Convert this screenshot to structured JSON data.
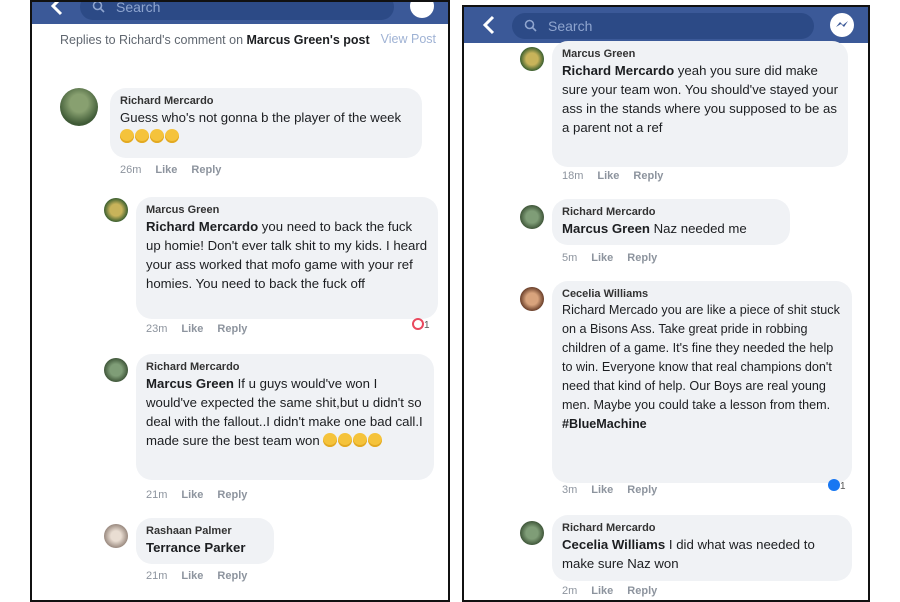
{
  "colors": {
    "fb_blue": "#3b5998",
    "bubble_bg": "#f0f2f5",
    "meta_gray": "#8d949e",
    "angry_red": "#e9495e",
    "like_blue": "#1877f2"
  },
  "left": {
    "search_placeholder": "Search",
    "header_prefix": "Replies to Richard's comment on",
    "header_owner": "Marcus Green's post",
    "view_post": "View Post",
    "comments": [
      {
        "author": "Richard Mercardo",
        "mention": "",
        "text": "Guess who's not gonna b the player of the week",
        "emoji_count": 4,
        "time": "26m",
        "like": "Like",
        "reply": "Reply"
      },
      {
        "author": "Marcus Green",
        "mention": "Richard Mercardo",
        "text": " you need to back the fuck up homie! Don't ever talk shit to my kids. I heard your ass worked that mofo game with your ref homies. You need to back the fuck off",
        "time": "23m",
        "like": "Like",
        "reply": "Reply",
        "reaction_count": "1"
      },
      {
        "author": "Richard Mercardo",
        "mention": "Marcus Green",
        "text": " If u guys would've won I would've expected the same shit,but u didn't so deal with the fallout..I didn't make one bad call.I made sure the best team won",
        "emoji_count": 4,
        "time": "21m",
        "like": "Like",
        "reply": "Reply"
      },
      {
        "author": "Rashaan Palmer",
        "mention": "Terrance Parker",
        "text": "",
        "time": "21m",
        "like": "Like",
        "reply": "Reply"
      }
    ]
  },
  "right": {
    "search_placeholder": "Search",
    "comments": [
      {
        "author": "Marcus Green",
        "mention": "Richard Mercardo",
        "text": "  yeah you sure did make sure your team won. You should've stayed your ass in the stands where you supposed to be as a parent not a ref",
        "time": "18m",
        "like": "Like",
        "reply": "Reply"
      },
      {
        "author": "Richard Mercardo",
        "mention": "Marcus Green",
        "text": " Naz needed me",
        "time": "5m",
        "like": "Like",
        "reply": "Reply"
      },
      {
        "author": "Cecelia Williams",
        "mention": "",
        "text": "Richard Mercado  you are like a piece of shit stuck on a Bisons Ass. Take great pride in robbing children of a game. It's fine they needed the help to win. Everyone know that real champions don't need that kind of help. Our Boys are real young men. Maybe you could take a lesson from them.",
        "hashtag": "#BlueMachine",
        "time": "3m",
        "like": "Like",
        "reply": "Reply",
        "reaction_count": "1"
      },
      {
        "author": "Richard Mercardo",
        "mention": "Cecelia Williams",
        "text": " I did what was needed to make sure Naz won",
        "time": "2m",
        "like": "Like",
        "reply": "Reply"
      }
    ]
  }
}
